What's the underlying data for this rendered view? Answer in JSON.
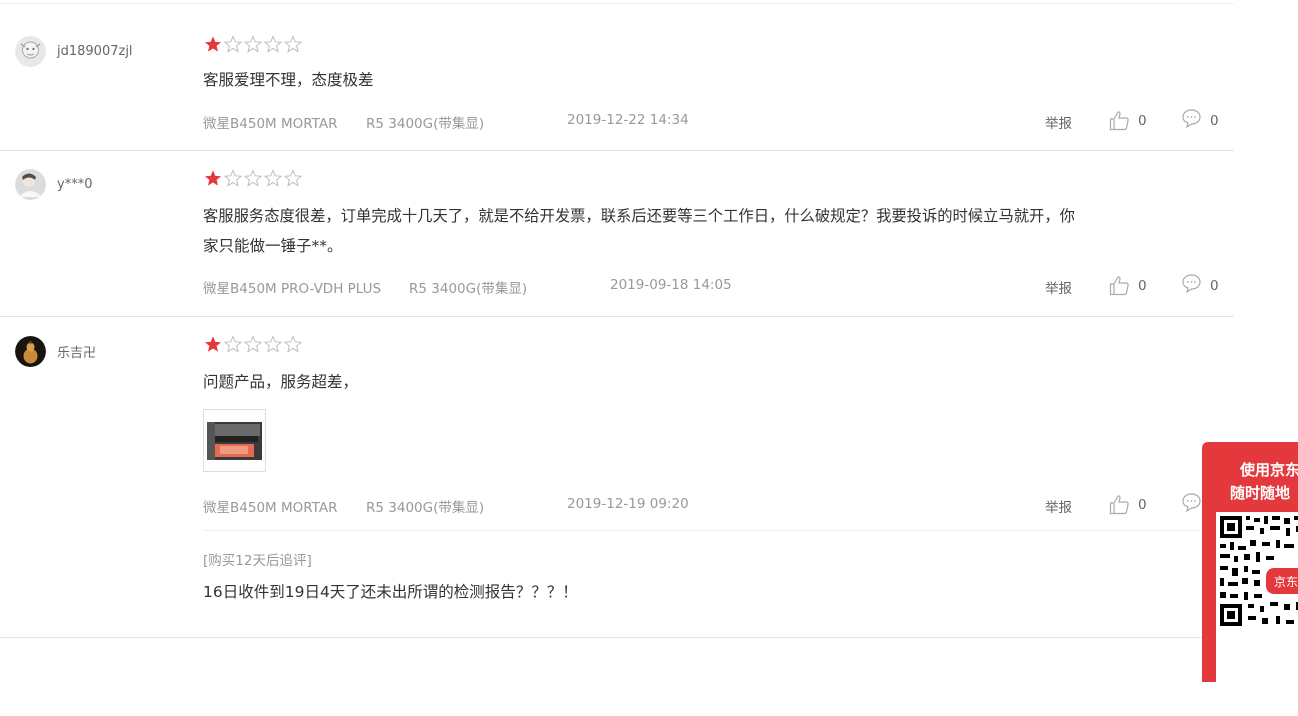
{
  "reviews": [
    {
      "username": "jd189007zjl",
      "rating": 1,
      "content": "客服爱理不理，态度极差",
      "spec1": "微星B450M MORTAR",
      "spec2": "R5 3400G(带集显)",
      "date": "2019-12-22 14:34",
      "report": "举报",
      "likes": "0",
      "replies": "0"
    },
    {
      "username": "y***0",
      "rating": 1,
      "content_line1": "客服服务态度很差，订单完成十几天了，就是不给开发票，联系后还要等三个工作日，什么破规定？我要投诉的时候立马就开，你",
      "content_line2": "家只能做一锤子**。",
      "spec1": "微星B450M PRO-VDH PLUS",
      "spec2": "R5 3400G(带集显)",
      "date": "2019-09-18 14:05",
      "report": "举报",
      "likes": "0",
      "replies": "0"
    },
    {
      "username": "乐吉卍",
      "rating": 1,
      "content": "问题产品，服务超差，",
      "spec1": "微星B450M MORTAR",
      "spec2": "R5 3400G(带集显)",
      "date": "2019-12-19 09:20",
      "report": "举报",
      "likes": "0",
      "followup_label": "[购买12天后追评]",
      "followup_text": "16日收件到19日4天了还未出所谓的检测报告？？？！"
    }
  ],
  "qr_panel": {
    "line1": "使用京东",
    "line2": "随时随地",
    "brand": "京东"
  },
  "colors": {
    "star_filled": "#e4393c",
    "star_empty": "#c8c8c8",
    "panel": "#e4393c"
  },
  "icons": [
    "user-avatar",
    "star-icon",
    "like-icon",
    "comment-icon",
    "qr-code"
  ]
}
